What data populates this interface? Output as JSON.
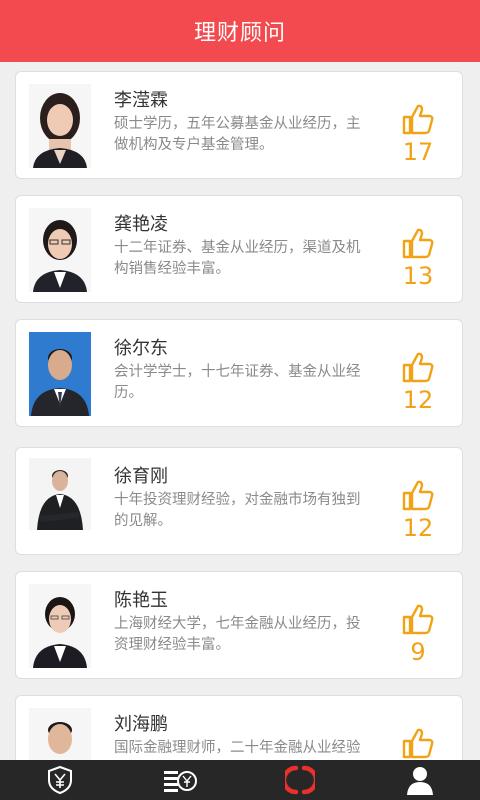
{
  "header": {
    "title": "理财顾问"
  },
  "advisors": [
    {
      "name": "李滢霖",
      "desc": "硕士学历，五年公募基金从业经历，主做机构及专户基金管理。",
      "likes": "17"
    },
    {
      "name": "龚艳凌",
      "desc": "十二年证券、基金从业经历，渠道及机构销售经验丰富。",
      "likes": "13"
    },
    {
      "name": "徐尔东",
      "desc": "会计学学士，十七年证券、基金从业经历。",
      "likes": "12"
    },
    {
      "name": "徐育刚",
      "desc": "十年投资理财经验，对金融市场有独到的见解。",
      "likes": "12"
    },
    {
      "name": "陈艳玉",
      "desc": "上海财经大学，七年金融从业经历，投资理财经验丰富。",
      "likes": "9"
    },
    {
      "name": "刘海鹏",
      "desc": "国际金融理财师，二十年金融从业经验",
      "likes": ""
    }
  ],
  "tabbar": {
    "items": [
      {
        "icon": "yen-shield-icon",
        "active": false
      },
      {
        "icon": "coin-list-icon",
        "active": false
      },
      {
        "icon": "red-ring-icon",
        "active": true
      },
      {
        "icon": "person-icon",
        "active": false
      }
    ]
  },
  "colors": {
    "header": "#f24a4f",
    "like": "#f2a215",
    "tabbar": "#272727",
    "accent_red": "#e8312b"
  }
}
